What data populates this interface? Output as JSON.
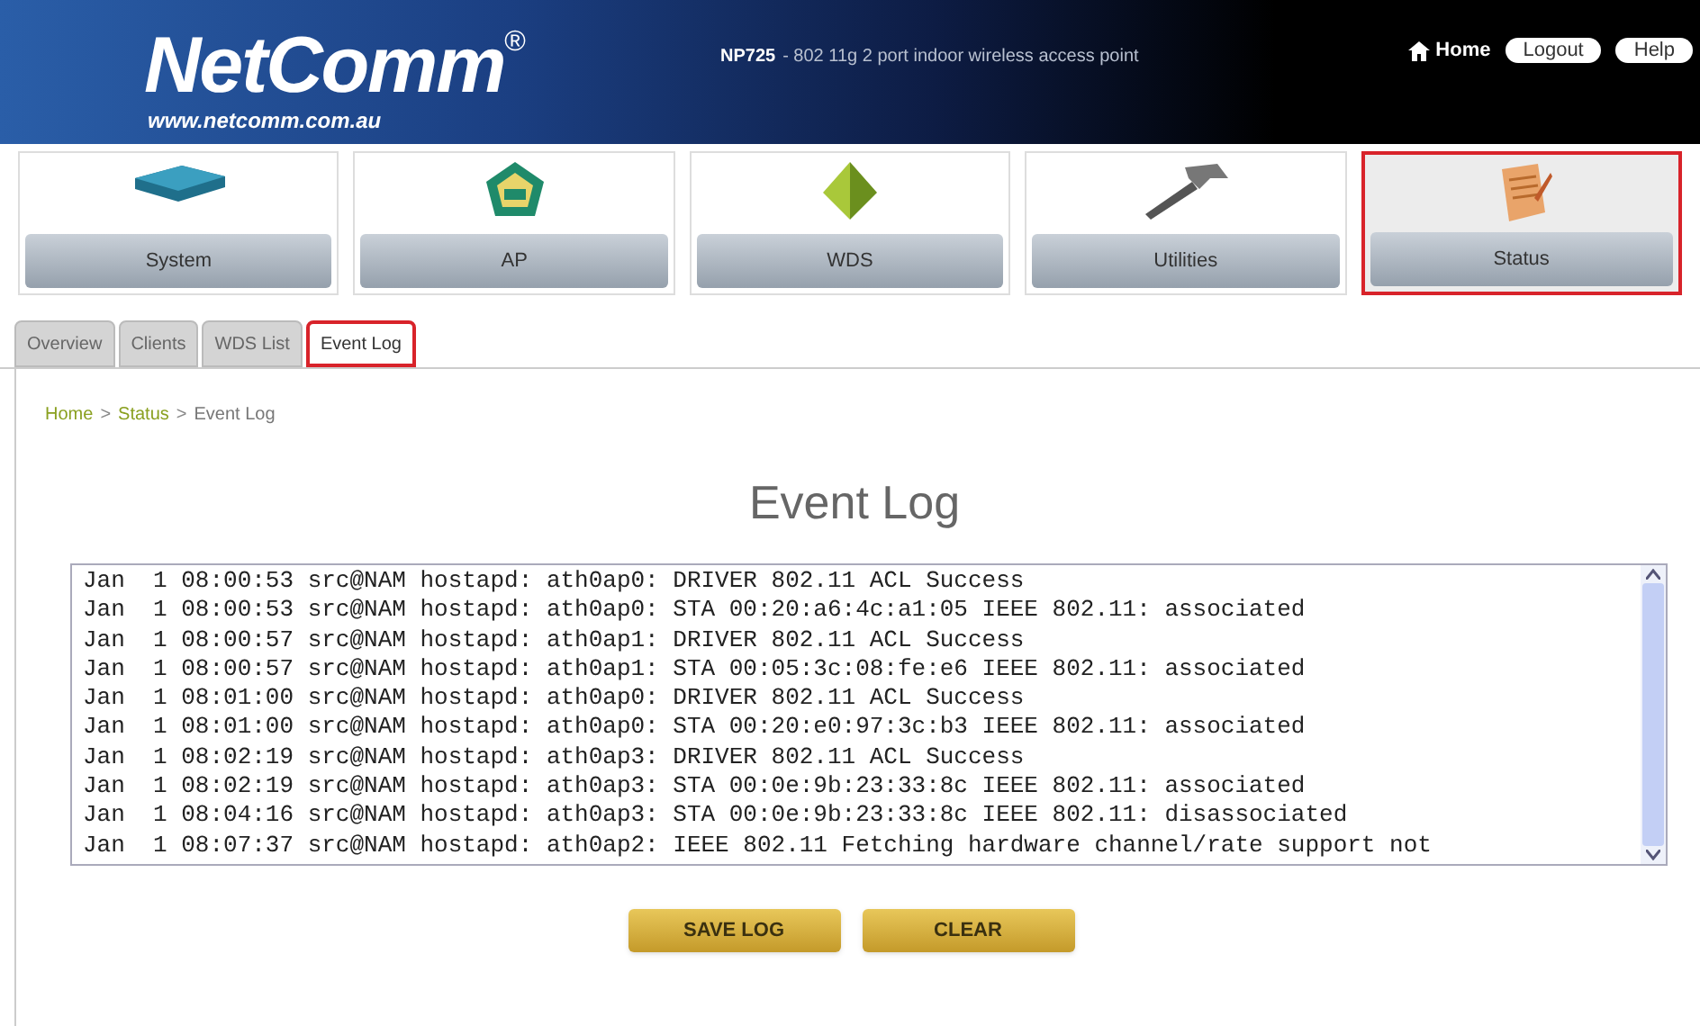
{
  "header": {
    "logo": "NetComm",
    "logo_mark": "®",
    "logo_url": "www.netcomm.com.au",
    "model": "NP725",
    "description": "- 802 11g 2 port indoor wireless access point",
    "links": [
      {
        "label": "Home",
        "kind": "plain"
      },
      {
        "label": "Logout",
        "kind": "pill"
      },
      {
        "label": "Help",
        "kind": "pill"
      }
    ]
  },
  "nav": [
    {
      "label": "System",
      "kind": "device",
      "selected": false
    },
    {
      "label": "AP",
      "kind": "ap",
      "selected": false
    },
    {
      "label": "WDS",
      "kind": "wds",
      "selected": false
    },
    {
      "label": "Utilities",
      "kind": "tools",
      "selected": false
    },
    {
      "label": "Status",
      "kind": "notes",
      "selected": true
    }
  ],
  "tabs": [
    {
      "label": "Overview",
      "selected": false
    },
    {
      "label": "Clients",
      "selected": false
    },
    {
      "label": "WDS List",
      "selected": false
    },
    {
      "label": "Event Log",
      "selected": true
    }
  ],
  "breadcrumb": {
    "separator": ">",
    "items": [
      {
        "label": "Home",
        "link": true
      },
      {
        "label": "Status",
        "link": true
      },
      {
        "label": "Event Log",
        "link": false
      }
    ]
  },
  "title": "Event Log",
  "log_lines": [
    "Jan  1 08:00:53 src@NAM hostapd: ath0ap0: DRIVER 802.11 ACL Success",
    "Jan  1 08:00:53 src@NAM hostapd: ath0ap0: STA 00:20:a6:4c:a1:05 IEEE 802.11: associated",
    "Jan  1 08:00:57 src@NAM hostapd: ath0ap1: DRIVER 802.11 ACL Success",
    "Jan  1 08:00:57 src@NAM hostapd: ath0ap1: STA 00:05:3c:08:fe:e6 IEEE 802.11: associated",
    "Jan  1 08:01:00 src@NAM hostapd: ath0ap0: DRIVER 802.11 ACL Success",
    "Jan  1 08:01:00 src@NAM hostapd: ath0ap0: STA 00:20:e0:97:3c:b3 IEEE 802.11: associated",
    "Jan  1 08:02:19 src@NAM hostapd: ath0ap3: DRIVER 802.11 ACL Success",
    "Jan  1 08:02:19 src@NAM hostapd: ath0ap3: STA 00:0e:9b:23:33:8c IEEE 802.11: associated",
    "Jan  1 08:04:16 src@NAM hostapd: ath0ap3: STA 00:0e:9b:23:33:8c IEEE 802.11: disassociated",
    "Jan  1 08:07:37 src@NAM hostapd: ath0ap2: IEEE 802.11 Fetching hardware channel/rate support not"
  ],
  "buttons": [
    "SAVE LOG",
    "CLEAR"
  ]
}
